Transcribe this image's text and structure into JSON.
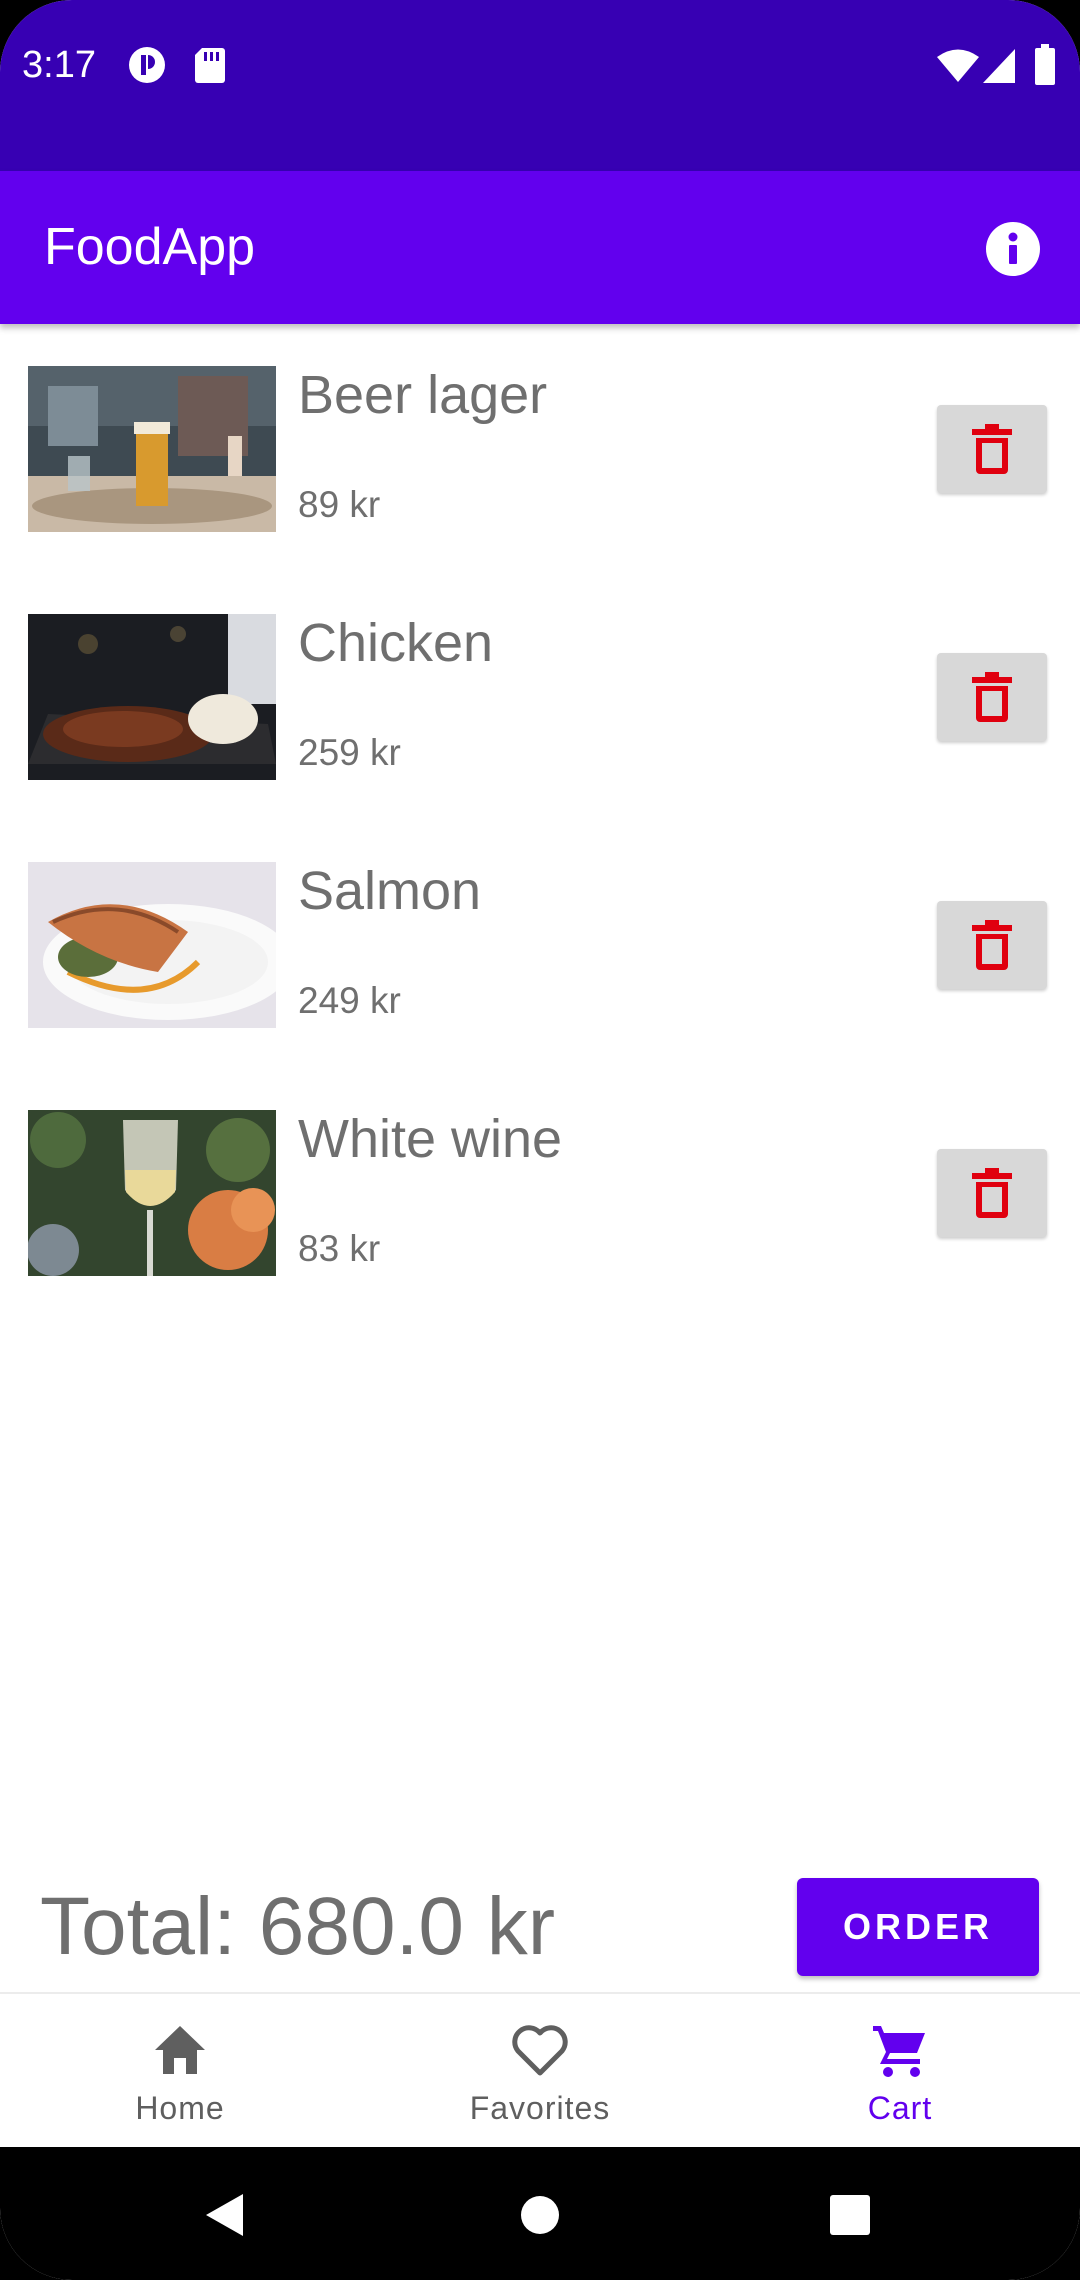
{
  "status_bar": {
    "time": "3:17",
    "left_icons": [
      "podcast-icon",
      "sd-card-icon"
    ],
    "right_icons": [
      "wifi-icon",
      "signal-icon",
      "battery-icon"
    ]
  },
  "app_bar": {
    "title": "FoodApp",
    "info_icon": "info-icon"
  },
  "cart": {
    "items": [
      {
        "name": "Beer lager",
        "price": "89 kr",
        "image": "beer-photo"
      },
      {
        "name": "Chicken",
        "price": "259 kr",
        "image": "chicken-photo"
      },
      {
        "name": "Salmon",
        "price": "249 kr",
        "image": "salmon-photo"
      },
      {
        "name": "White wine",
        "price": "83 kr",
        "image": "wine-photo"
      }
    ],
    "delete_icon": "trash-icon"
  },
  "total": {
    "label": "Total: 680.0 kr"
  },
  "order_button": {
    "label": "ORDER"
  },
  "bottom_nav": {
    "items": [
      {
        "label": "Home",
        "icon": "home-icon",
        "active": false
      },
      {
        "label": "Favorites",
        "icon": "heart-icon",
        "active": false
      },
      {
        "label": "Cart",
        "icon": "cart-icon",
        "active": true
      }
    ]
  },
  "system_nav": {
    "buttons": [
      "back-icon",
      "home-circle-icon",
      "recents-icon"
    ]
  },
  "colors": {
    "status_bar": "#3700b3",
    "primary": "#6200ee",
    "delete_icon": "#e0000f",
    "text_gray": "#6f6f6f",
    "nav_inactive": "#5f5f5f"
  }
}
